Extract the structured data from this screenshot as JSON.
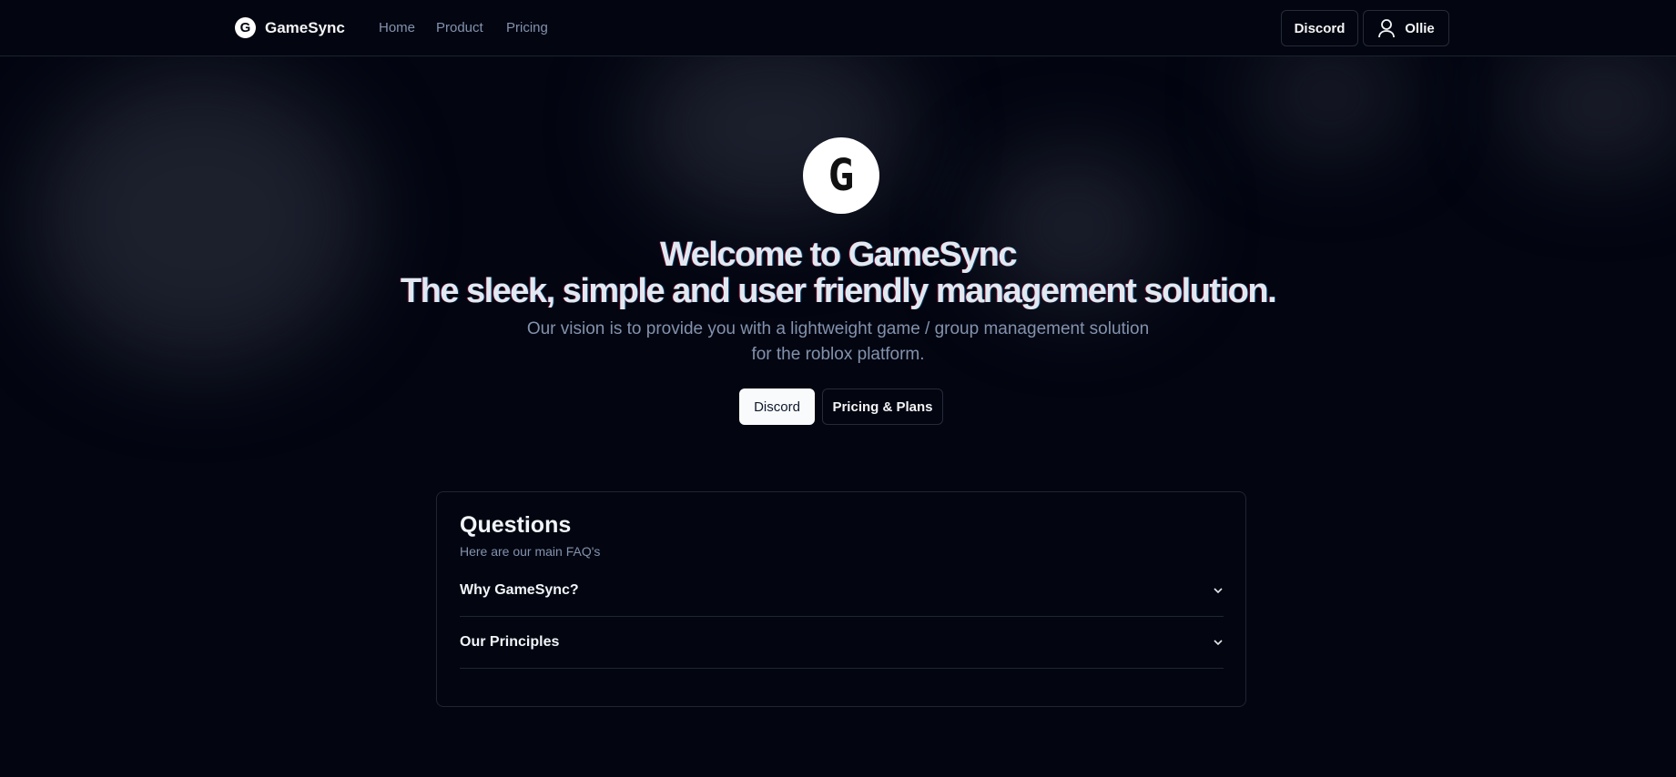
{
  "nav": {
    "brand": "GameSync",
    "logo_letter": "G",
    "links": [
      "Home",
      "Product",
      "Pricing"
    ],
    "discord": "Discord",
    "user": "Ollie"
  },
  "hero": {
    "logo_letter": "G",
    "title_line1": "Welcome to GameSync",
    "title_line2": "The sleek, simple and user friendly management solution.",
    "subtitle_line1": "Our vision is to provide you with a lightweight game / group management solution",
    "subtitle_line2": "for the roblox platform.",
    "primary_button": "Discord",
    "secondary_button": "Pricing & Plans"
  },
  "faq": {
    "title": "Questions",
    "description": "Here are our main FAQ's",
    "items": [
      "Why GameSync?",
      "Our Principles"
    ]
  }
}
